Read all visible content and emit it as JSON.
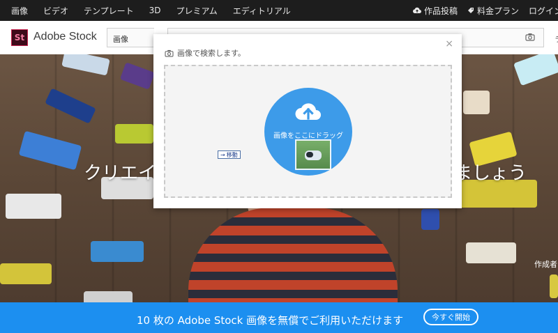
{
  "topnav": {
    "left_items": [
      "画像",
      "ビデオ",
      "テンプレート",
      "3D",
      "プレミアム",
      "エディトリアル"
    ],
    "right_items": [
      {
        "label": "作品投稿",
        "icon": "cloud-upload-icon"
      },
      {
        "label": "料金プラン",
        "icon": "tag-icon"
      },
      {
        "label": "ログイン",
        "icon": ""
      }
    ]
  },
  "header": {
    "logo_text": "St",
    "brand": "Adobe Stock",
    "search_type": "画像",
    "search_value": "",
    "extra": "ラ"
  },
  "hero": {
    "headline_left": "クリエイ",
    "headline_right": "ましょう",
    "author_label": "作成者"
  },
  "modal": {
    "title": "画像で検索します。",
    "close": "×",
    "drag_text": "画像をここにドラッグ",
    "move_tip": "移動"
  },
  "banner": {
    "text": "10 枚の Adobe Stock 画像を無償でご利用いただけます",
    "button": "今すぐ開始"
  },
  "colors": {
    "accent_blue": "#3d9be9",
    "banner_blue": "#1c8ff0",
    "nav_bg": "#1d1d1d"
  }
}
